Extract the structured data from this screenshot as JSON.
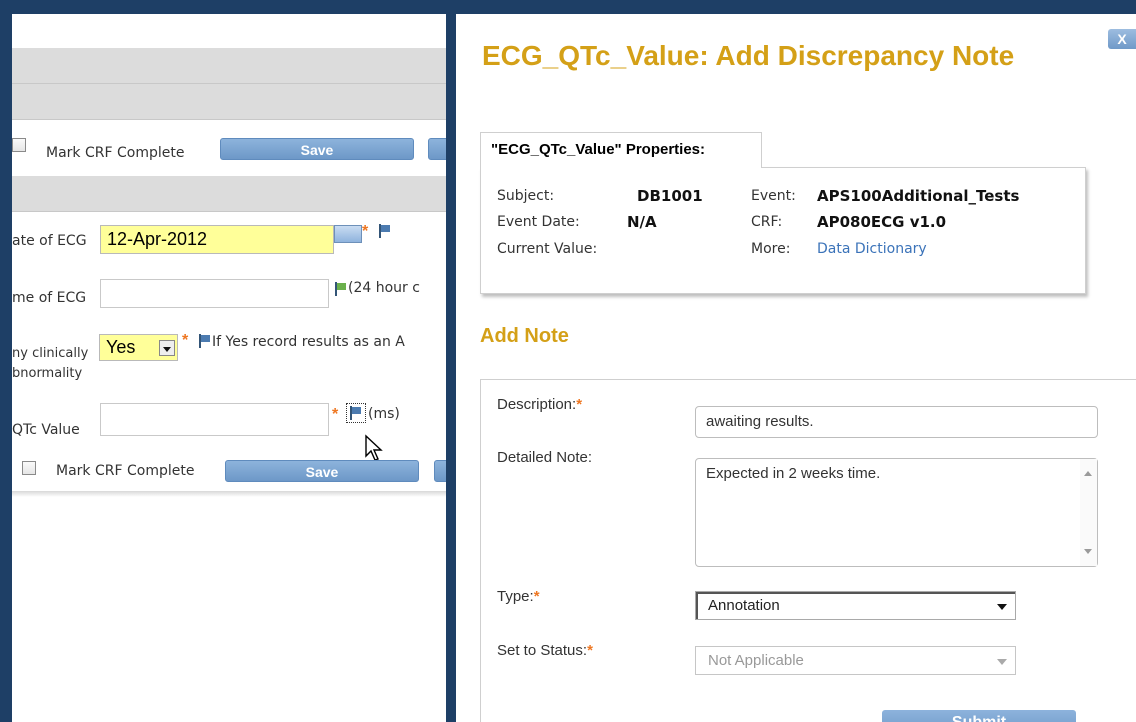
{
  "crf": {
    "mark_complete_label": "Mark CRF Complete",
    "save_label": "Save",
    "date_label": "ate of ECG",
    "date_value": "12-Apr-2012",
    "time_label": "me of ECG",
    "time_hint": "(24 hour c",
    "clinically_label_1": "ny clinically",
    "clinically_label_2": "bnormality",
    "clinically_value": "Yes",
    "clinically_hint": "If Yes record results as an A",
    "qtc_label": "QTc Value",
    "qtc_unit": "(ms)"
  },
  "dialog": {
    "title": "ECG_QTc_Value: Add Discrepancy Note",
    "close_label": "X",
    "properties_tab": "\"ECG_QTc_Value\" Properties:",
    "subject_label": "Subject:",
    "subject_value": "DB1001",
    "event_label": "Event:",
    "event_value": "APS100Additional_Tests",
    "event_date_label": "Event Date:",
    "event_date_value": "N/A",
    "crf_label": "CRF:",
    "crf_value": "AP080ECG v1.0",
    "current_value_label": "Current Value:",
    "more_label": "More:",
    "more_link": "Data Dictionary",
    "add_note_heading": "Add Note",
    "description_label": "Description:",
    "description_value": "awaiting results.",
    "detailed_note_label": "Detailed Note:",
    "detailed_note_value": "Expected in 2 weeks time.",
    "type_label": "Type:",
    "type_value": "Annotation",
    "status_label": "Set to Status:",
    "status_value": "Not Applicable",
    "required_mark": "*",
    "submit_label": "Submit"
  },
  "colors": {
    "title_gold": "#d4a017",
    "button_blue": "#7aa3d2",
    "required_orange": "#ee7722",
    "highlight_yellow": "#ffff99",
    "frame_navy": "#1e3f66"
  }
}
